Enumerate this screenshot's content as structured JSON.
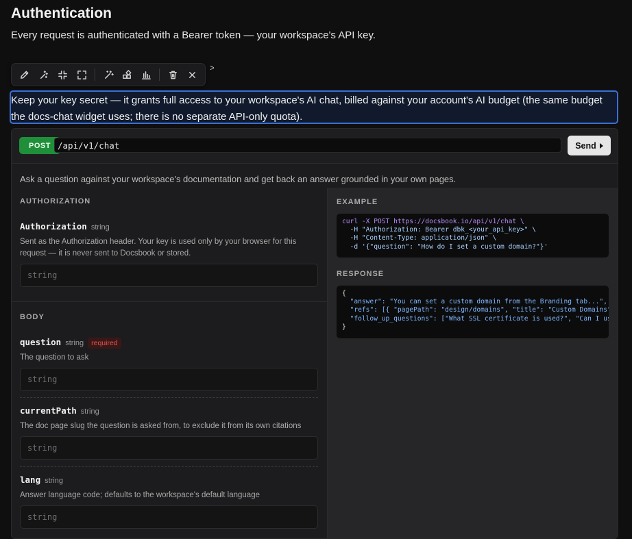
{
  "page": {
    "title": "Authentication",
    "subtitle": "Every request is authenticated with a Bearer token — your workspace's API key.",
    "hidden_line": ">",
    "selected_paragraph": "Keep your key secret — it grants full access to your workspace's AI chat, billed against your account's AI budget (the same budget the docs-chat widget uses; there is no separate API-only quota)."
  },
  "toolbar": {
    "icons": [
      "pencil-icon",
      "sparkles-icon",
      "collapse-icon",
      "expand-icon",
      "magic-wand-icon",
      "widgets-icon",
      "bar-chart-icon",
      "trash-icon",
      "close-icon"
    ]
  },
  "api": {
    "method": "POST",
    "path": "/api/v1/chat",
    "send_label": "Send",
    "description": "Ask a question against your workspace's documentation and get back an answer grounded in your own pages.",
    "authorization": {
      "section_label": "AUTHORIZATION",
      "name": "Authorization",
      "type": "string",
      "description": "Sent as the Authorization header. Your key is used only by your browser for this request — it is never sent to Docsbook or stored.",
      "placeholder": "string"
    },
    "body": {
      "section_label": "BODY",
      "params": [
        {
          "name": "question",
          "type": "string",
          "required_label": "required",
          "description": "The question to ask",
          "placeholder": "string"
        },
        {
          "name": "currentPath",
          "type": "string",
          "description": "The doc page slug the question is asked from, to exclude it from its own citations",
          "placeholder": "string"
        },
        {
          "name": "lang",
          "type": "string",
          "description": "Answer language code; defaults to the workspace's default language",
          "placeholder": "string"
        }
      ]
    },
    "example": {
      "label": "EXAMPLE",
      "lines": [
        "curl -X POST https://docsbook.io/api/v1/chat \\",
        "  -H \"Authorization: Bearer dbk_<your_api_key>\" \\",
        "  -H \"Content-Type: application/json\" \\",
        "  -d '{\"question\": \"How do I set a custom domain?\"}'"
      ]
    },
    "response": {
      "label": "RESPONSE",
      "lines": [
        "{",
        "  \"answer\": \"You can set a custom domain from the Branding tab...\",",
        "  \"refs\": [{ \"pagePath\": \"design/domains\", \"title\": \"Custom Domains\" }],",
        "  \"follow_up_questions\": [\"What SSL certificate is used?\", \"Can I use a subdomain?\"]",
        "}"
      ]
    }
  }
}
